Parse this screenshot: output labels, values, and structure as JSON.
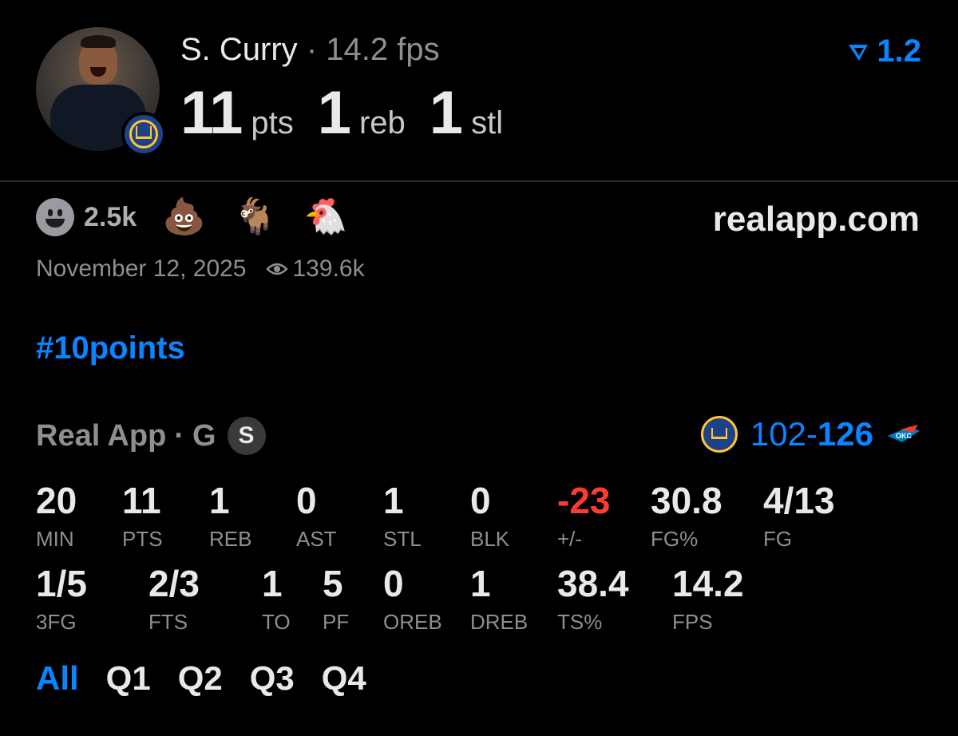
{
  "header": {
    "player_name": "S. Curry",
    "separator": "·",
    "fps_text": "14.2 fps",
    "version": "1.2",
    "statline": [
      {
        "value": "11",
        "unit": "pts"
      },
      {
        "value": "1",
        "unit": "reb"
      },
      {
        "value": "1",
        "unit": "stl"
      }
    ]
  },
  "reactions": {
    "count": "2.5k",
    "emojis": [
      "💩",
      "🐐",
      "🐔"
    ]
  },
  "site": "realapp.com",
  "meta": {
    "date": "November 12, 2025",
    "views": "139.6k"
  },
  "hashtag": "#10points",
  "game": {
    "source": "Real App",
    "position": "G",
    "badge": "S",
    "home_score": "102",
    "dash": "-",
    "away_score": "126"
  },
  "stats_row1": [
    {
      "value": "20",
      "label": "MIN"
    },
    {
      "value": "11",
      "label": "PTS"
    },
    {
      "value": "1",
      "label": "REB"
    },
    {
      "value": "0",
      "label": "AST"
    },
    {
      "value": "1",
      "label": "STL"
    },
    {
      "value": "0",
      "label": "BLK"
    },
    {
      "value": "-23",
      "label": "+/-"
    },
    {
      "value": "30.8",
      "label": "FG%"
    },
    {
      "value": "4/13",
      "label": "FG"
    }
  ],
  "stats_row2": [
    {
      "value": "1/5",
      "label": "3FG"
    },
    {
      "value": "2/3",
      "label": "FTS"
    },
    {
      "value": "1",
      "label": "TO"
    },
    {
      "value": "5",
      "label": "PF"
    },
    {
      "value": "0",
      "label": "OREB"
    },
    {
      "value": "1",
      "label": "DREB"
    },
    {
      "value": "38.4",
      "label": "TS%"
    },
    {
      "value": "14.2",
      "label": "FPS"
    }
  ],
  "tabs": [
    "All",
    "Q1",
    "Q2",
    "Q3",
    "Q4"
  ],
  "colors": {
    "accent": "#0a84ff",
    "negative": "#ff3b30",
    "background": "#000000",
    "muted": "#8e8e93"
  }
}
